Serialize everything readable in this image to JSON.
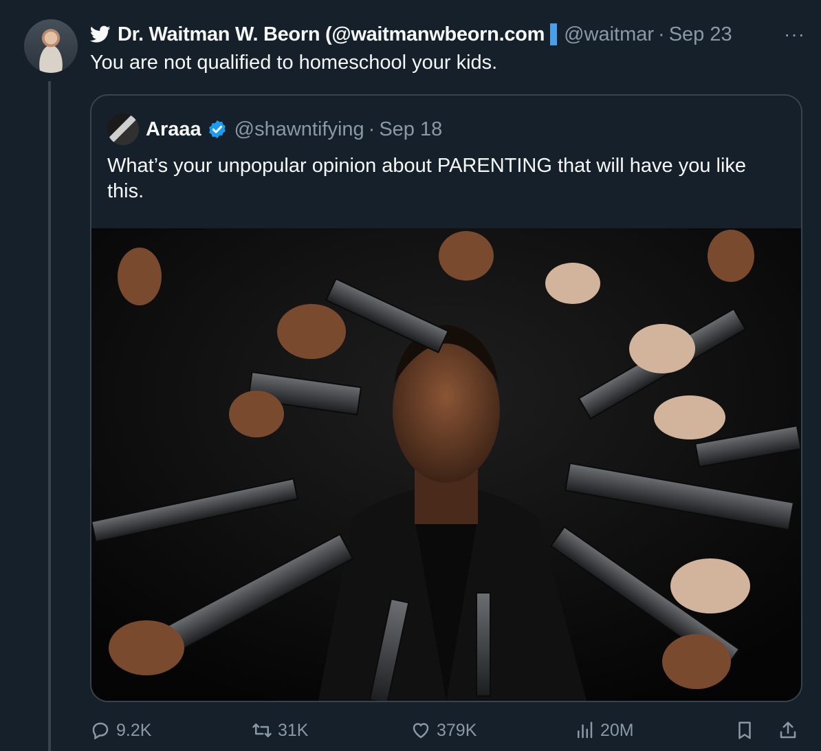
{
  "colors": {
    "background": "#15202b",
    "text": "#f7f9f9",
    "muted": "#8b98a5",
    "border": "#38444d",
    "accent": "#1d9bf0"
  },
  "tweet": {
    "author_name": "Dr. Waitman W. Beorn (@waitmanwbeorn.com",
    "author_handle": "@waitmar",
    "separator": "·",
    "date": "Sep 23",
    "more": "···",
    "text": "You are not qualified to homeschool your kids.",
    "icons": [
      "twitter-bird-icon",
      "more-icon"
    ]
  },
  "quote": {
    "author_name": "Araaa",
    "author_handle": "@shawntifying",
    "separator": "·",
    "date": "Sep 18",
    "text": "What’s your unpopular opinion about PARENTING that will have you like this.",
    "verified_icon": "verified-badge-icon"
  },
  "actions": {
    "replies": "9.2K",
    "retweets": "31K",
    "likes": "379K",
    "views": "20M",
    "icons": [
      "reply-icon",
      "retweet-icon",
      "like-icon",
      "views-icon",
      "bookmark-icon",
      "share-icon"
    ]
  }
}
